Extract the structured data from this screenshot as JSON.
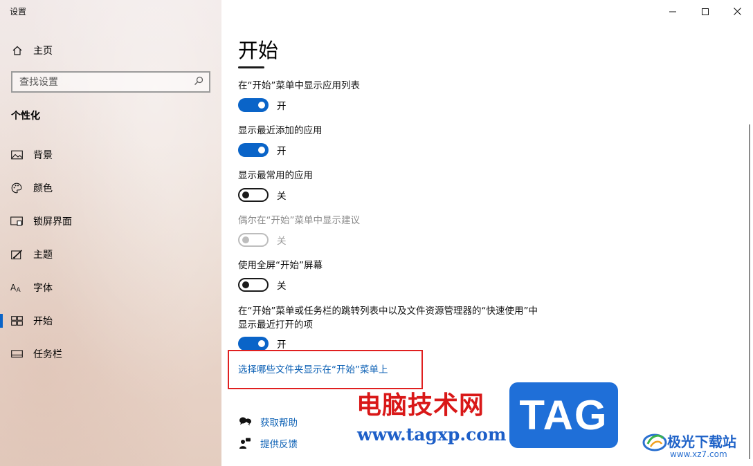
{
  "window": {
    "title": "设置"
  },
  "sidebar": {
    "home_label": "主页",
    "search_placeholder": "查找设置",
    "section_title": "个性化",
    "items": [
      {
        "label": "背景",
        "icon": "picture-icon",
        "active": false
      },
      {
        "label": "颜色",
        "icon": "palette-icon",
        "active": false
      },
      {
        "label": "锁屏界面",
        "icon": "lock-screen-icon",
        "active": false
      },
      {
        "label": "主题",
        "icon": "theme-brush-icon",
        "active": false
      },
      {
        "label": "字体",
        "icon": "font-icon",
        "active": false
      },
      {
        "label": "开始",
        "icon": "start-tiles-icon",
        "active": true
      },
      {
        "label": "任务栏",
        "icon": "taskbar-icon",
        "active": false
      }
    ]
  },
  "main": {
    "page_title": "开始",
    "settings": [
      {
        "title": "在“开始”菜单中显示应用列表",
        "state": "开",
        "on": true,
        "disabled": false
      },
      {
        "title": "显示最近添加的应用",
        "state": "开",
        "on": true,
        "disabled": false
      },
      {
        "title": "显示最常用的应用",
        "state": "关",
        "on": false,
        "disabled": false
      },
      {
        "title": "偶尔在“开始”菜单中显示建议",
        "state": "关",
        "on": false,
        "disabled": true
      },
      {
        "title": "使用全屏“开始”屏幕",
        "state": "关",
        "on": false,
        "disabled": false
      },
      {
        "title_line1": "在“开始”菜单或任务栏的跳转列表中以及文件资源管理器的“快速使用”中",
        "title_line2": "显示最近打开的项",
        "state": "开",
        "on": true,
        "disabled": false
      }
    ],
    "folders_link": "选择哪些文件夹显示在“开始”菜单上",
    "help_link": "获取帮助",
    "feedback_link": "提供反馈"
  },
  "watermark": {
    "cn_text": "电脑技术网",
    "url": "www.tagxp.com",
    "tag": "TAG",
    "site_name": "极光下载站",
    "site_url": "www.xz7.com"
  },
  "colors": {
    "accent": "#0a64c8",
    "link": "#0a5fb4",
    "highlight_box": "#e02020"
  }
}
